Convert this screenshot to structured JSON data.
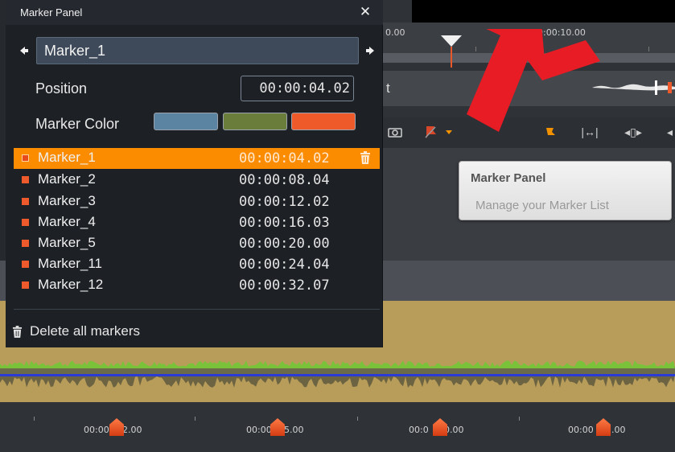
{
  "panel": {
    "title": "Marker Panel",
    "close_label": "✕",
    "prev_label": "◆",
    "next_label": "➡",
    "marker_name": "Marker_1",
    "position_label": "Position",
    "position_value": "00:00:04.02",
    "color_label": "Marker Color",
    "colors": [
      "#5b84a2",
      "#6a7d3b",
      "#ef5a2b"
    ],
    "markers": [
      {
        "name": "Marker_1",
        "time": "00:00:04.02",
        "selected": true
      },
      {
        "name": "Marker_2",
        "time": "00:00:08.04"
      },
      {
        "name": "Marker_3",
        "time": "00:00:12.02"
      },
      {
        "name": "Marker_4",
        "time": "00:00:16.03"
      },
      {
        "name": "Marker_5",
        "time": "00:00:20.00"
      },
      {
        "name": "Marker_11",
        "time": "00:00:24.04"
      },
      {
        "name": "Marker_12",
        "time": "00:00:32.07"
      }
    ],
    "delete_all_label": "Delete all markers"
  },
  "tooltip": {
    "title": "Marker Panel",
    "description": "Manage your Marker List"
  },
  "timeline": {
    "top_ruler_labels": [
      "0.00",
      "00:00:10.00"
    ],
    "audio_row_partial_text": "t",
    "bottom_ruler_labels": [
      "00:00",
      "2.00",
      "00:00",
      "5.00",
      "00:0",
      "0.00",
      "00:00",
      ".00"
    ]
  },
  "colors": {
    "selected_row": "#fb8c00",
    "marker_dot": "#ee5a2c",
    "arrow": "#e81c24",
    "waveform_bg": "#b89c5a",
    "waveform_line": "#2b3cd6",
    "waveform_green": "#79c23a"
  }
}
